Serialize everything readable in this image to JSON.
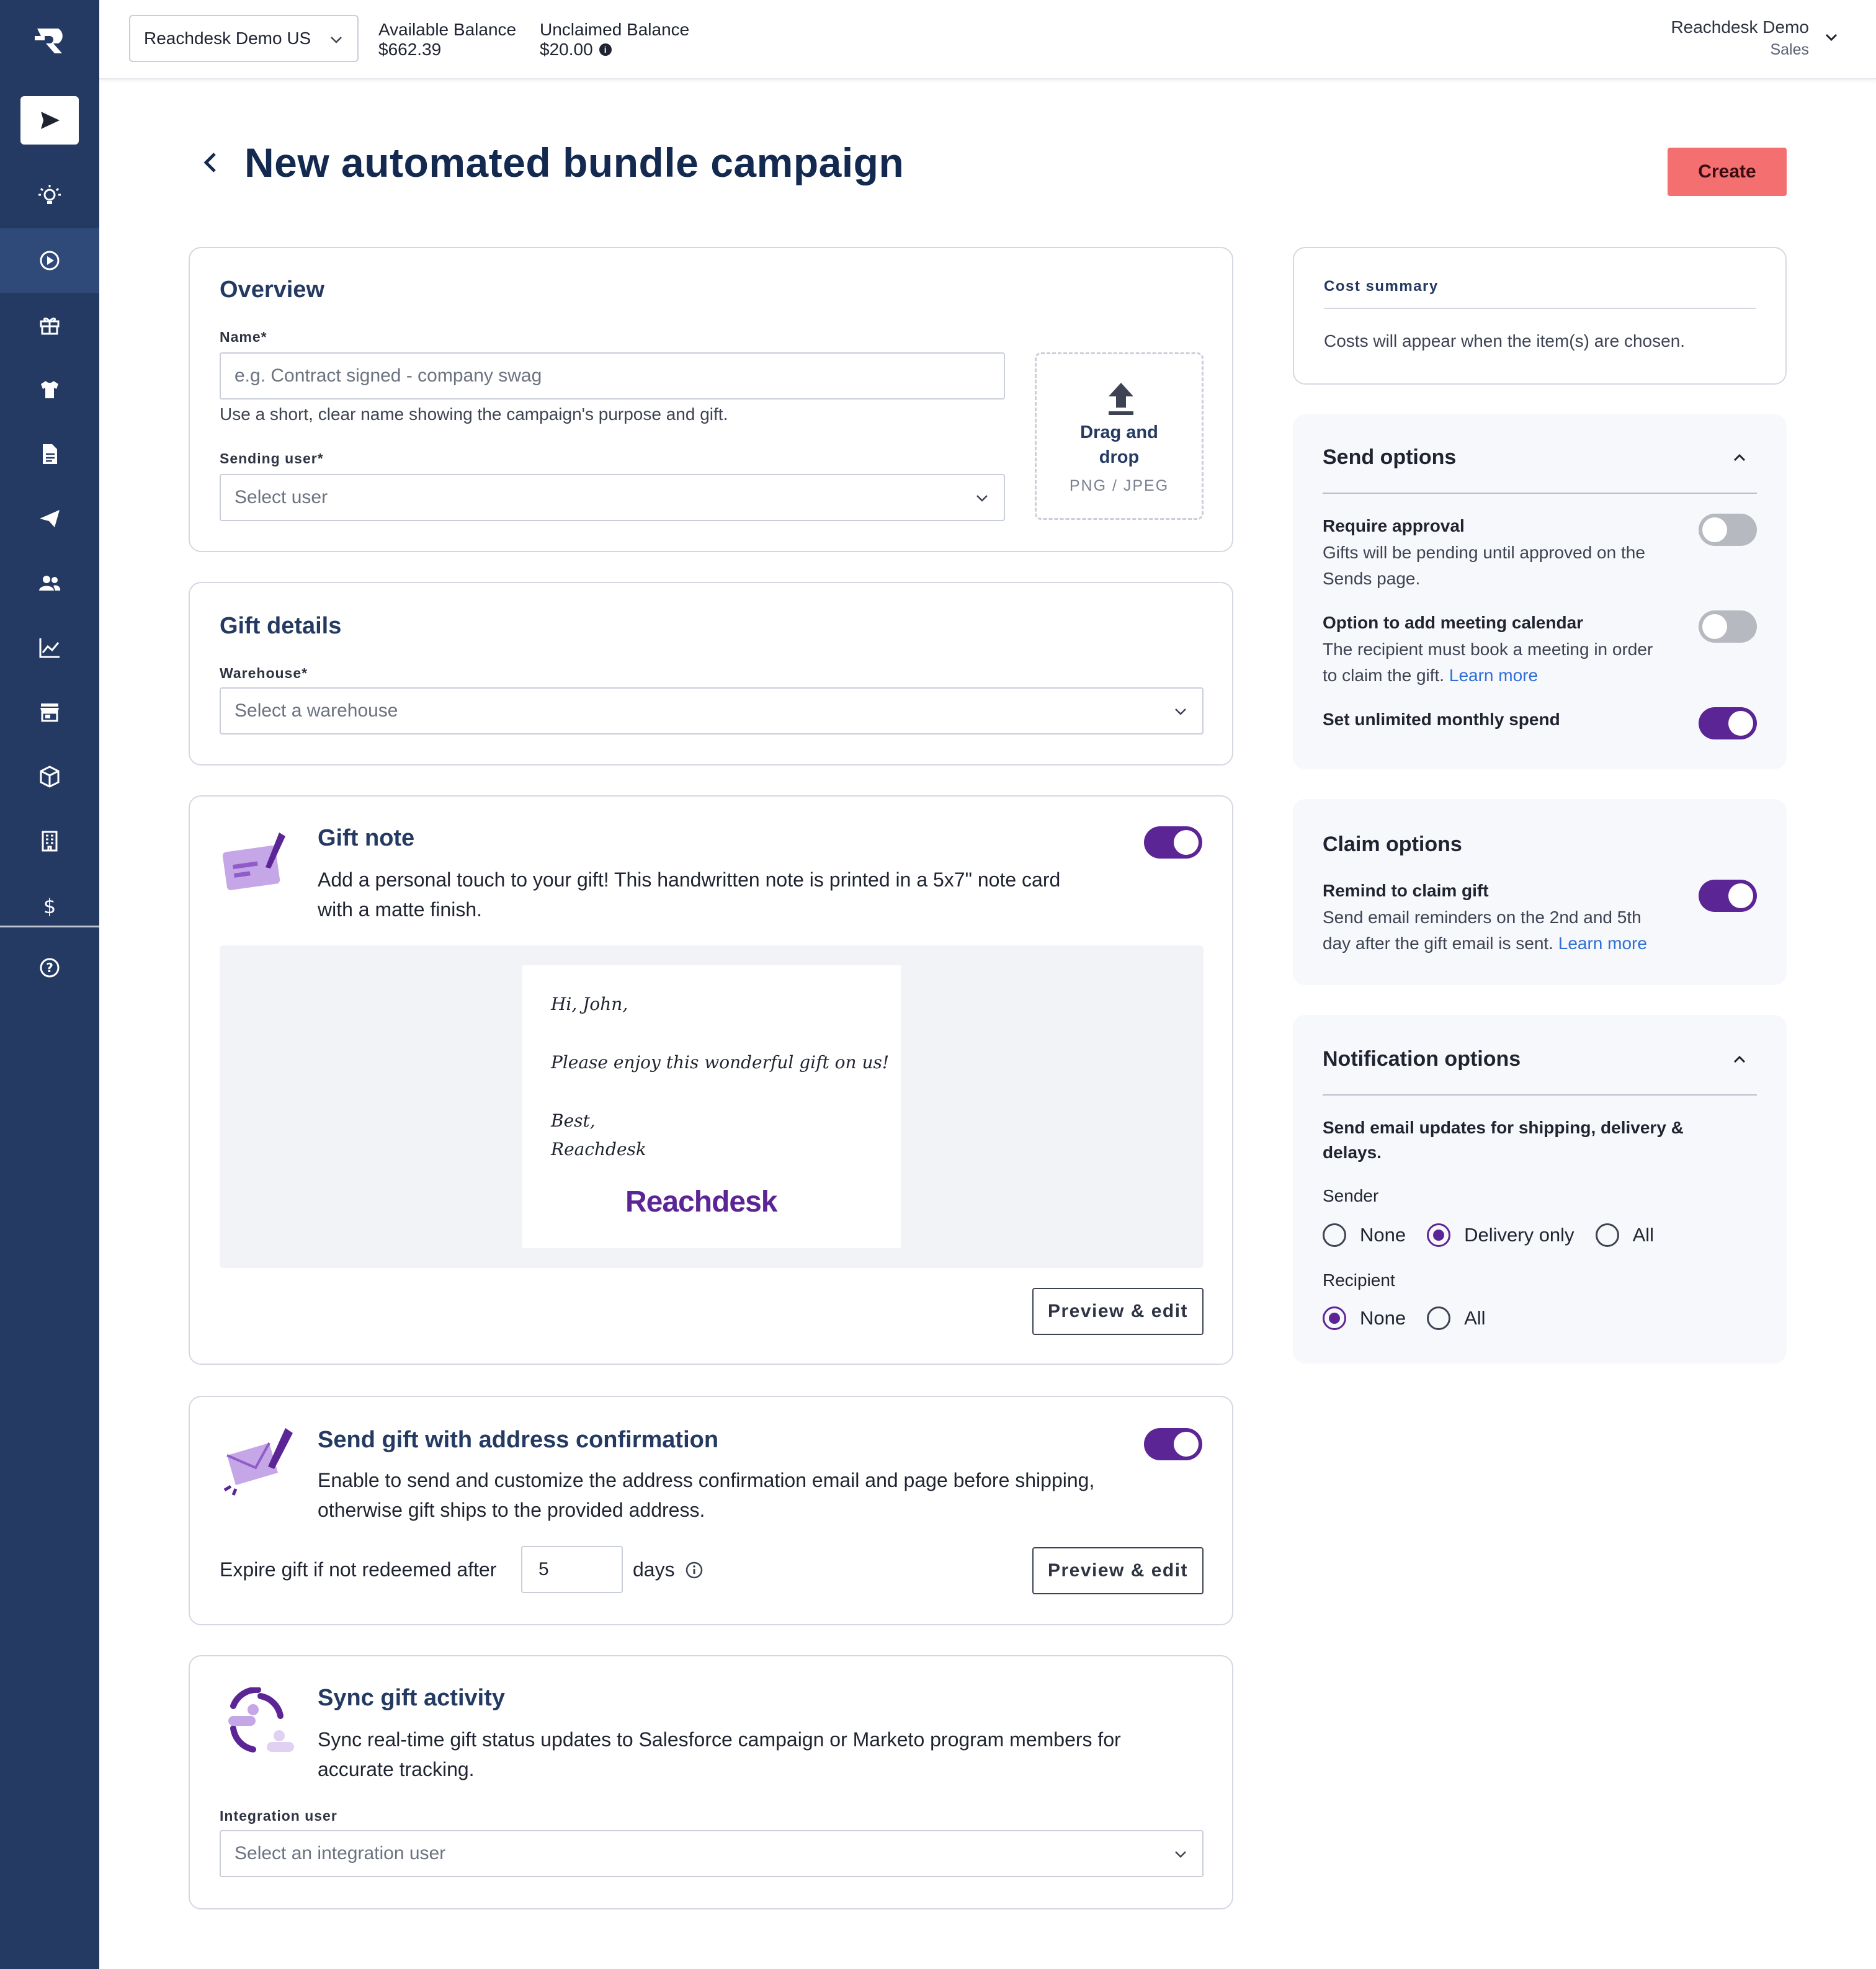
{
  "topbar": {
    "account": "Reachdesk Demo US",
    "available_label": "Available Balance",
    "available_value": "$662.39",
    "unclaimed_label": "Unclaimed Balance",
    "unclaimed_value": "$20.00",
    "user_name": "Reachdesk Demo",
    "user_role": "Sales"
  },
  "header": {
    "title": "New automated bundle campaign",
    "create_label": "Create"
  },
  "overview": {
    "title": "Overview",
    "name_label": "Name*",
    "name_placeholder": "e.g. Contract signed - company swag",
    "name_help": "Use a short, clear name showing the campaign's purpose and gift.",
    "sending_user_label": "Sending user*",
    "sending_user_value": "Select user",
    "upload_line1": "Drag and",
    "upload_line2": "drop",
    "upload_formats": "PNG / JPEG"
  },
  "gift_details": {
    "title": "Gift details",
    "warehouse_label": "Warehouse*",
    "warehouse_value": "Select a warehouse"
  },
  "gift_note": {
    "title": "Gift note",
    "desc_line1": "Add a personal touch to your gift! This handwritten note is printed in a 5x7\" note card",
    "desc_line2": "with a matte finish.",
    "enabled": true,
    "note_greeting": "Hi, John,",
    "note_body": "Please enjoy this wonderful gift on us!",
    "note_signoff": "Best,",
    "note_signature": "Reachdesk",
    "note_logo": "Reachdesk",
    "preview_label": "Preview & edit"
  },
  "address_confirmation": {
    "title": "Send gift with address confirmation",
    "desc_line1": "Enable to send and customize the address confirmation email and page before shipping,",
    "desc_line2": "otherwise gift ships to the provided address.",
    "enabled": true,
    "expire_label": "Expire gift if not redeemed after",
    "expire_value": "5",
    "days_label": "days",
    "preview_label": "Preview & edit"
  },
  "sync": {
    "title": "Sync gift activity",
    "desc_line1": "Sync real-time gift status updates to Salesforce campaign or Marketo program members for",
    "desc_line2": "accurate tracking.",
    "integration_label": "Integration user",
    "integration_value": "Select an integration user"
  },
  "cost_summary": {
    "title": "Cost summary",
    "text": "Costs will appear when the item(s) are chosen."
  },
  "send_options": {
    "title": "Send options",
    "approval_title": "Require approval",
    "approval_desc_line1": "Gifts will be pending until approved on the",
    "approval_desc_line2": "Sends page.",
    "approval_on": false,
    "meeting_title": "Option to add meeting calendar",
    "meeting_desc_line1": "The recipient must book a meeting in order",
    "meeting_desc_line2": "to claim the gift.",
    "meeting_link": "Learn more",
    "meeting_on": false,
    "unlimited_title": "Set unlimited monthly spend",
    "unlimited_on": true
  },
  "claim_options": {
    "title": "Claim options",
    "remind_title": "Remind to claim gift",
    "remind_desc_line1": "Send email reminders on the 2nd and 5th",
    "remind_desc_line2": "day after the gift email is sent.",
    "remind_link": "Learn more",
    "remind_on": true
  },
  "notification_options": {
    "title": "Notification options",
    "desc_line1": "Send email updates for shipping, delivery &",
    "desc_line2": "delays.",
    "sender_label": "Sender",
    "sender_options": [
      "None",
      "Delivery only",
      "All"
    ],
    "sender_selected": "Delivery only",
    "recipient_label": "Recipient",
    "recipient_options": [
      "None",
      "All"
    ],
    "recipient_selected": "None"
  },
  "colors": {
    "sidebar": "#243a63",
    "accent": "#5c2596",
    "create_button": "#f46f6f",
    "link": "#2f6fd6"
  }
}
